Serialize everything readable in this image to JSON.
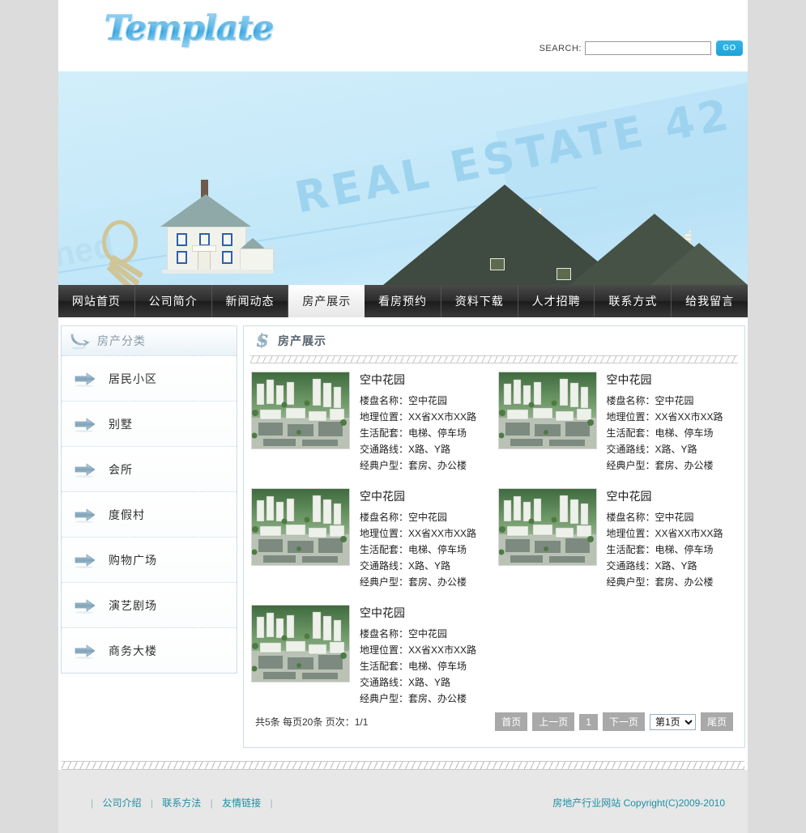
{
  "site": {
    "logo_text": "Template"
  },
  "search": {
    "label": "SEARCH:",
    "value": "",
    "placeholder": "",
    "button_label": "GO"
  },
  "banner": {
    "watermark_main": "REAL ESTATE 42",
    "watermark_faint": "ned"
  },
  "nav": {
    "items": [
      {
        "label": "网站首页",
        "active": false
      },
      {
        "label": "公司简介",
        "active": false
      },
      {
        "label": "新闻动态",
        "active": false
      },
      {
        "label": "房产展示",
        "active": true
      },
      {
        "label": "看房预约",
        "active": false
      },
      {
        "label": "资料下载",
        "active": false
      },
      {
        "label": "人才招聘",
        "active": false
      },
      {
        "label": "联系方式",
        "active": false
      },
      {
        "label": "给我留言",
        "active": false
      }
    ]
  },
  "sidebar": {
    "title": "房产分类",
    "icon": "curved-arrow-icon",
    "items": [
      {
        "label": "居民小区",
        "icon": "arrow-right-icon"
      },
      {
        "label": "别墅",
        "icon": "arrow-right-icon"
      },
      {
        "label": "会所",
        "icon": "arrow-right-icon"
      },
      {
        "label": "度假村",
        "icon": "arrow-right-icon"
      },
      {
        "label": "购物广场",
        "icon": "arrow-right-icon"
      },
      {
        "label": "演艺剧场",
        "icon": "arrow-right-icon"
      },
      {
        "label": "商务大楼",
        "icon": "arrow-right-icon"
      }
    ]
  },
  "content": {
    "title": "房产展示",
    "icon": "dollar-s-icon",
    "properties": [
      {
        "name": "空中花园",
        "lines": [
          "楼盘名称：空中花园",
          "地理位置：XX省XX市XX路",
          "生活配套：电梯、停车场",
          "交通路线：X路、Y路",
          "经典户型：套房、办公楼"
        ]
      },
      {
        "name": "空中花园",
        "lines": [
          "楼盘名称：空中花园",
          "地理位置：XX省XX市XX路",
          "生活配套：电梯、停车场",
          "交通路线：X路、Y路",
          "经典户型：套房、办公楼"
        ]
      },
      {
        "name": "空中花园",
        "lines": [
          "楼盘名称：空中花园",
          "地理位置：XX省XX市XX路",
          "生活配套：电梯、停车场",
          "交通路线：X路、Y路",
          "经典户型：套房、办公楼"
        ]
      },
      {
        "name": "空中花园",
        "lines": [
          "楼盘名称：空中花园",
          "地理位置：XX省XX市XX路",
          "生活配套：电梯、停车场",
          "交通路线：X路、Y路",
          "经典户型：套房、办公楼"
        ]
      },
      {
        "name": "空中花园",
        "lines": [
          "楼盘名称：空中花园",
          "地理位置：XX省XX市XX路",
          "生活配套：电梯、停车场",
          "交通路线：X路、Y路",
          "经典户型：套房、办公楼"
        ]
      }
    ]
  },
  "pagination": {
    "info": "共5条 每页20条 页次：1/1",
    "first": "首页",
    "prev": "上一页",
    "current_num": "1",
    "next": "下一页",
    "select_value": "第1页",
    "last": "尾页"
  },
  "footer": {
    "links": [
      "公司介绍",
      "联系方法",
      "友情链接"
    ],
    "separator": "|",
    "copyright": "房地产行业网站  Copyright(C)2009-2010"
  },
  "colors": {
    "page_bg": "#dcdcdc",
    "accent_blue": "#1ba3da",
    "nav_dark": "#2c2c2c",
    "footer_teal": "#1f8fa5",
    "panel_border": "#cfdde6"
  }
}
